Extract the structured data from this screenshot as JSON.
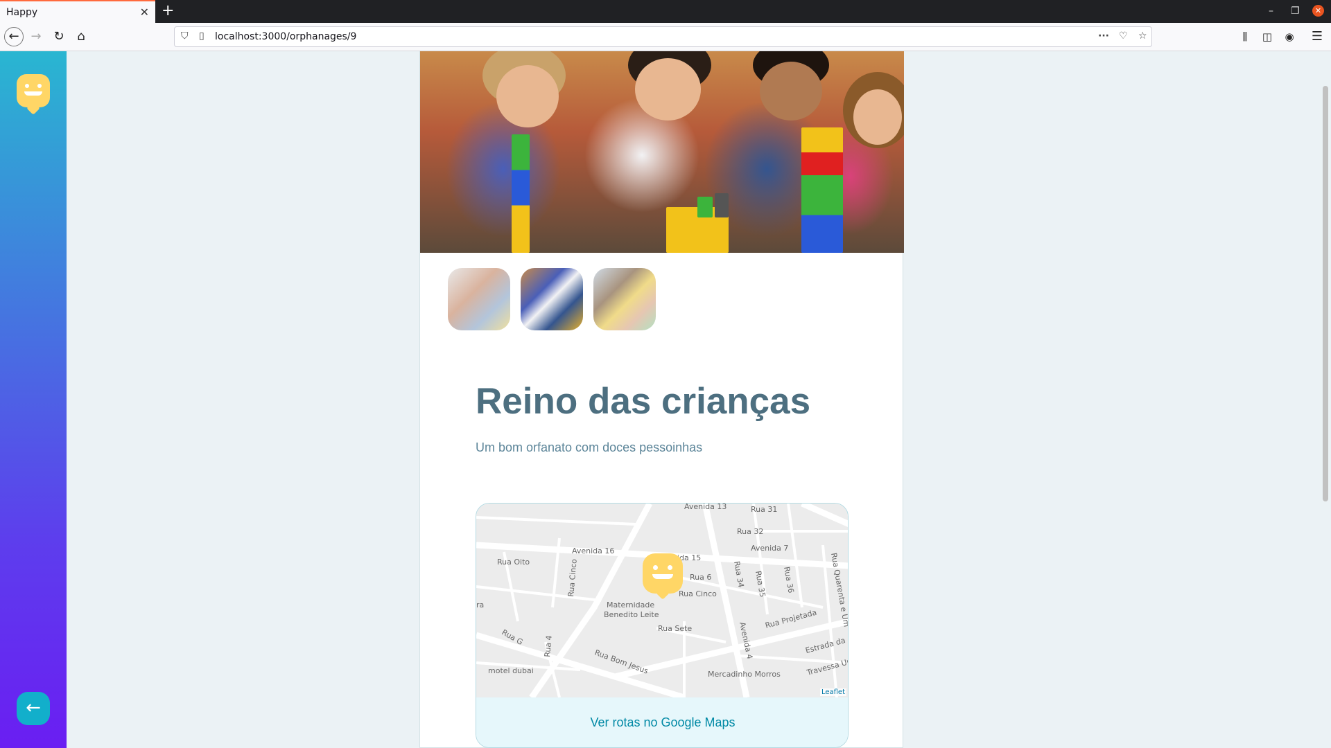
{
  "browser": {
    "tab_title": "Happy",
    "url": "localhost:3000/orphanages/9"
  },
  "orphanage": {
    "name": "Reino das crianças",
    "about": "Um bom orfanato com doces pessoinhas",
    "map_link_label": "Ver rotas no Google Maps",
    "map_attribution": "Leaflet",
    "map_labels": {
      "avenida_13": "Avenida 13",
      "rua_31": "Rua 31",
      "rua_32": "Rua 32",
      "avenida_7": "Avenida 7",
      "avenida_16": "Avenida 16",
      "avenida_15": "ida 15",
      "rua_oito": "Rua Oito",
      "rua_cinco_v": "Rua Cinco",
      "rua_6": "Rua 6",
      "rua_34": "Rua 34",
      "rua_35": "Rua 35",
      "rua_36": "Rua 36",
      "rua_quarenta": "Rua Quarenta e Um",
      "rua_cinco_h": "Rua Cinco",
      "maternidade": "Maternidade",
      "benedito": "Benedito Leite",
      "rua_sete": "Rua Sete",
      "rua_projetada": "Rua Projetada",
      "avenida_4": "Avenida 4",
      "estrada": "Estrada da",
      "rua_g": "Rua G",
      "rua_bom_jesus": "Rua Bom Jesus",
      "motel": "motel dubai",
      "rua_4": "Rua 4",
      "mercadinho": "Mercadinho Morros",
      "travessa": "Travessa Ur",
      "ra": "ra"
    }
  }
}
